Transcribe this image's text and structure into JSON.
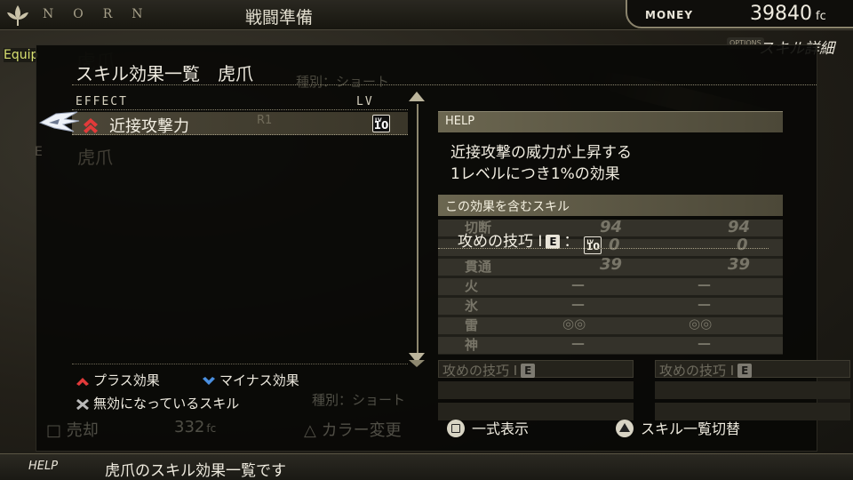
{
  "header": {
    "brand": "NORN",
    "screen_title": "戦闘準備",
    "money_label": "MONEY",
    "money_value": "39840",
    "money_unit": "fc",
    "options_tag": "OPTIONS",
    "skill_detail": "スキル詳細",
    "equip_tab": "Equip"
  },
  "modal": {
    "title": "スキル効果一覧　虎爪",
    "ghost_type": "種別：ショート",
    "col_effect": "EFFECT",
    "col_lv": "LV",
    "effects": [
      {
        "name": "近接攻撃力",
        "direction": "plus",
        "level": "10",
        "shortcut": "R1"
      }
    ],
    "ghost_item": "虎爪",
    "ghost_e": "E",
    "legend": {
      "plus": "プラス効果",
      "minus": "マイナス効果",
      "disabled": "無効になっているスキル"
    },
    "ghost_type_bottom": "種別：ショート"
  },
  "help": {
    "header": "HELP",
    "line1": "近接攻撃の威力が上昇する",
    "line2": "1レベルにつき1%の効果"
  },
  "included_skills": {
    "header": "この効果を含むスキル",
    "skill_name": "攻めの技巧 I",
    "skill_badge": "E",
    "separator": "：",
    "level": "10"
  },
  "ghost_stats": {
    "rows": [
      "切断",
      "",
      "貫通",
      "火",
      "氷",
      "雷",
      "神"
    ],
    "left": [
      "94",
      "0",
      "39",
      "—",
      "—",
      "◎◎",
      "—"
    ],
    "right": [
      "94",
      "0",
      "39",
      "—",
      "—",
      "◎◎",
      "—"
    ],
    "skill_box_left": "攻めの技巧 I",
    "skill_box_right": "攻めの技巧 I",
    "skill_box_badge": "E"
  },
  "buttons": {
    "full_display": "一式表示",
    "switch_list": "スキル一覧切替"
  },
  "ghost_bottom": {
    "sell": "売却",
    "sell_value": "332",
    "sell_unit": "fc",
    "color_change": "カラー変更"
  },
  "status_bar": {
    "label": "HELP",
    "text": "虎爪のスキル効果一覧です"
  },
  "colors": {
    "accent_panel": "#6b6650",
    "plus_arrow": "#e23a3a",
    "minus_arrow": "#4a8fe0",
    "text": "#f0ece0"
  }
}
